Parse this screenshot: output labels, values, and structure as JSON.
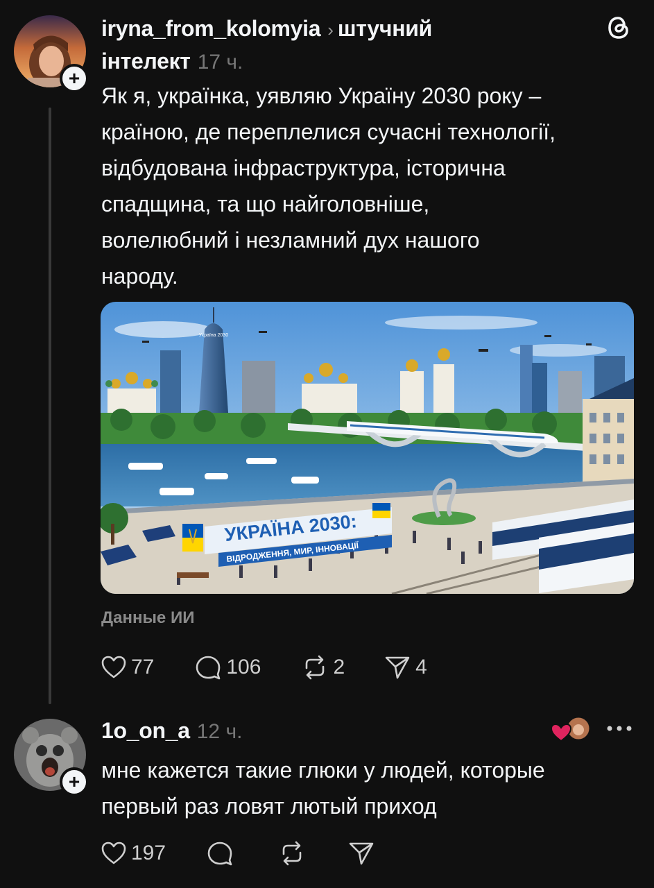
{
  "post": {
    "username": "iryna_from_kolomyia",
    "topic_line1": "штучний",
    "topic_line2": "інтелект",
    "time": "17 ч.",
    "text_lines": [
      "Як я, українка, уявляю Україну 2030 року –",
      "країною, де переплелися сучасні технології,",
      "відбудована інфраструктура, історична",
      "спадщина, та що найголовніше,",
      "волелюбний і незламний дух нашого",
      "народу."
    ],
    "image": {
      "banner_title": "УКРАЇНА 2030:",
      "banner_subtitle": "ВІДРОДЖЕННЯ, МИР, ІННОВАЦІЇ",
      "tower_label": "Україна 2030"
    },
    "ai_label": "Данные ИИ",
    "likes": "77",
    "replies": "106",
    "reposts": "2",
    "shares": "4"
  },
  "reply": {
    "username": "1o_on_a",
    "time": "12 ч.",
    "text_lines": [
      "мне кажется такие глюки у людей, которые",
      "первый раз ловят лютый приход"
    ],
    "likes": "197"
  },
  "icons": {
    "threads_logo": "threads-logo-icon",
    "like": "heart-icon",
    "reply": "speech-bubble-icon",
    "repost": "repost-icon",
    "share": "paper-plane-icon",
    "more": "more-dots-icon"
  },
  "colors": {
    "background": "#101010",
    "text": "#f3f5f7",
    "muted": "#777777",
    "heart_red": "#e0245e"
  }
}
